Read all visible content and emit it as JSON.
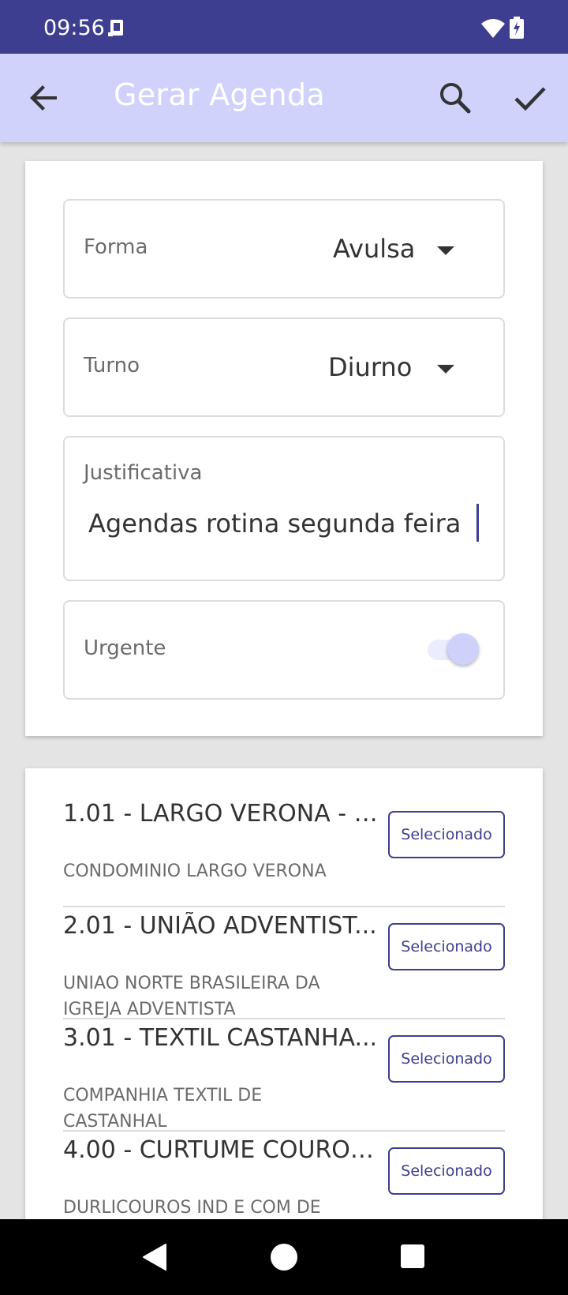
{
  "status_bar": {
    "time": "09:56"
  },
  "app_bar": {
    "title": "Gerar Agenda"
  },
  "form": {
    "forma": {
      "label": "Forma",
      "value": "Avulsa"
    },
    "turno": {
      "label": "Turno",
      "value": "Diurno"
    },
    "justificativa": {
      "label": "Justificativa",
      "value": "Agendas rotina segunda feira"
    },
    "urgente": {
      "label": "Urgente",
      "checked": true
    }
  },
  "list": {
    "items": [
      {
        "title": "1.01 - LARGO VERONA - P...",
        "subtitle": "CONDOMINIO LARGO VERONA",
        "button": "Selecionado"
      },
      {
        "title": "2.01 - UNIÃO ADVENTIST...",
        "subtitle": "UNIAO NORTE BRASILEIRA DA IGREJA ADVENTISTA",
        "button": "Selecionado"
      },
      {
        "title": "3.01 - TEXTIL CASTANHA...",
        "subtitle": "COMPANHIA TEXTIL DE CASTANHAL",
        "button": "Selecionado"
      },
      {
        "title": "4.00 - CURTUME COURO ...",
        "subtitle": "DURLICOUROS IND E COM DE",
        "button": "Selecionado"
      }
    ]
  },
  "colors": {
    "status_bar": "#3d3e90",
    "app_bar": "#d0d2fb",
    "accent": "#3d3e90",
    "toggle_thumb": "#cfd1fb"
  }
}
